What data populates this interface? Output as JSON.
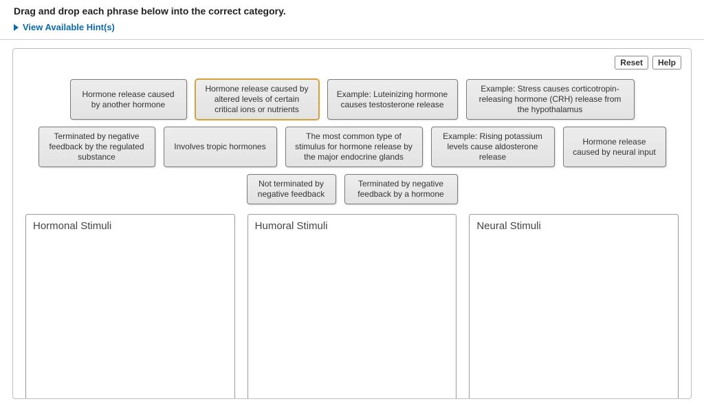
{
  "header": {
    "instruction": "Drag and drop each phrase below into the correct category.",
    "hints_label": "View Available Hint(s)"
  },
  "toolbar": {
    "reset": "Reset",
    "help": "Help"
  },
  "chips": {
    "r1": {
      "c1": "Hormone release caused by another hormone",
      "c2": "Hormone release caused by altered levels of certain critical ions or nutrients",
      "c3": "Example: Luteinizing hormone causes testosterone release",
      "c4": "Example: Stress causes corticotropin-releasing hormone (CRH) release from the hypothalamus"
    },
    "r2": {
      "c1": "Terminated by negative feedback by the regulated substance",
      "c2": "Involves tropic hormones",
      "c3": "The most common type of stimulus for hormone release by the major endocrine glands",
      "c4": "Example: Rising potassium levels cause aldosterone release",
      "c5": "Hormone release caused by neural input"
    },
    "r3": {
      "c1": "Not terminated by negative feedback",
      "c2": "Terminated by negative feedback by a hormone"
    }
  },
  "drops": {
    "d1": "Hormonal Stimuli",
    "d2": "Humoral Stimuli",
    "d3": "Neural Stimuli"
  }
}
